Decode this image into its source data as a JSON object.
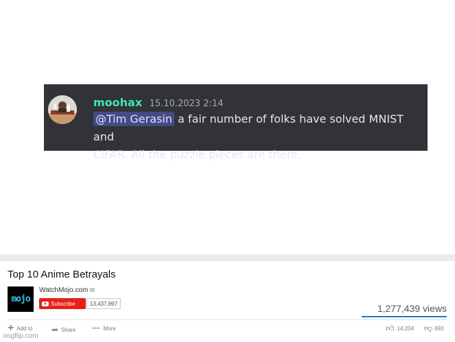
{
  "discord": {
    "username": "moohax",
    "timestamp": "15.10.2023 2:14",
    "mention": "@Tim Gerasin",
    "message_line1": " a fair number of folks have solved MNIST and",
    "message_line2": "CIFAR. All the puzzle pieces are there."
  },
  "youtube": {
    "video_title": "Top 10 Anime Betrayals",
    "channel_logo_text": "mojo",
    "channel_name": "WatchMojo.com",
    "subscribe_label": "Subscribe",
    "subscriber_count": "13,437,897",
    "views": "1,277,439 views",
    "actions": {
      "add_label": "Add to",
      "share_label": "Share",
      "more_label": "More"
    },
    "likes": "14,204",
    "dislikes": "693"
  },
  "watermark": "imgflip.com",
  "colors": {
    "discord_bg": "#313338",
    "username": "#3ee6b3",
    "mention_bg": "#444b86",
    "subscribe_red": "#e62117",
    "views_bar": "#167ac6"
  }
}
